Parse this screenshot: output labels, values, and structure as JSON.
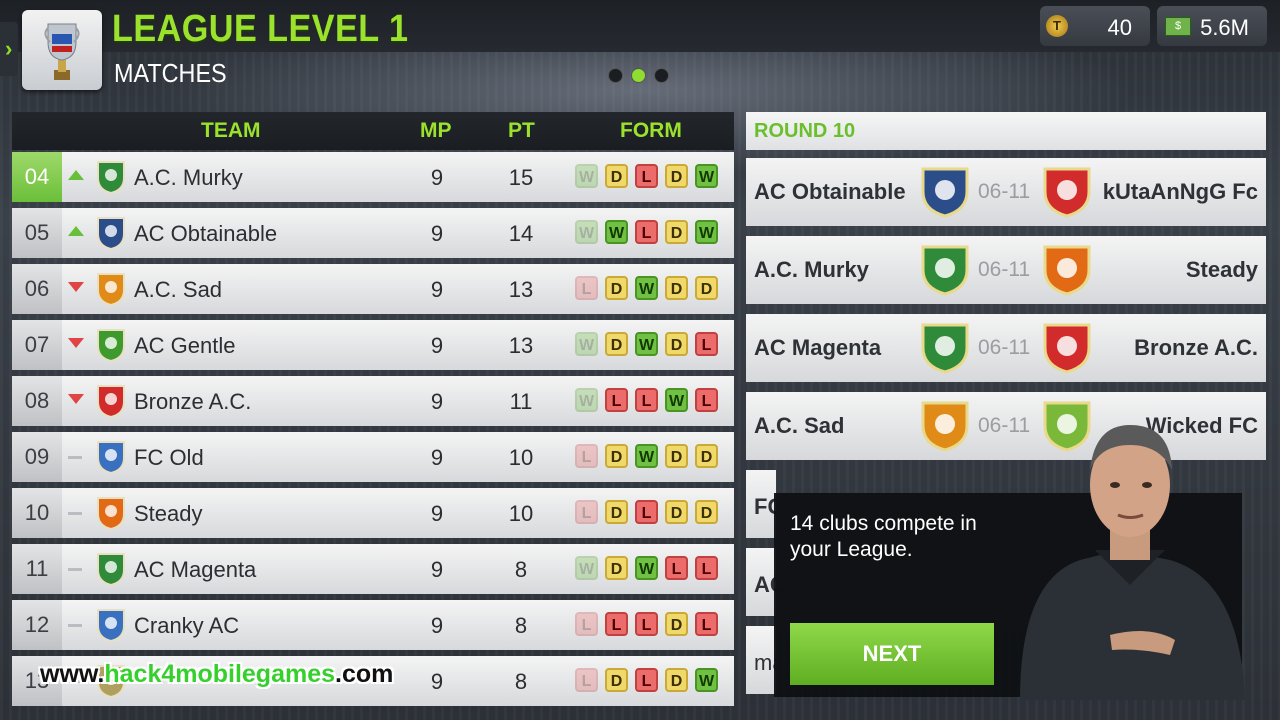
{
  "header": {
    "title": "LEAGUE LEVEL 1",
    "subtitle": "MATCHES",
    "coins": "40",
    "coin_icon_letter": "T",
    "cash": "5.6M",
    "cash_icon_symbol": "$",
    "page_dots": {
      "count": 3,
      "active": 2
    }
  },
  "table": {
    "headers": {
      "team": "TEAM",
      "mp": "MP",
      "pt": "PT",
      "form": "FORM"
    },
    "rows": [
      {
        "rank": "04",
        "trend": "up",
        "team": "A.C. Murky",
        "mp": "9",
        "pt": "15",
        "form": [
          "W",
          "D",
          "L",
          "D",
          "W"
        ],
        "faded": 1
      },
      {
        "rank": "05",
        "trend": "up",
        "team": "AC Obtainable",
        "mp": "9",
        "pt": "14",
        "form": [
          "W",
          "W",
          "L",
          "D",
          "W"
        ],
        "faded": 1
      },
      {
        "rank": "06",
        "trend": "down",
        "team": "A.C. Sad",
        "mp": "9",
        "pt": "13",
        "form": [
          "L",
          "D",
          "W",
          "D",
          "D"
        ],
        "faded": 1
      },
      {
        "rank": "07",
        "trend": "down",
        "team": "AC Gentle",
        "mp": "9",
        "pt": "13",
        "form": [
          "W",
          "D",
          "W",
          "D",
          "L"
        ],
        "faded": 1
      },
      {
        "rank": "08",
        "trend": "down",
        "team": "Bronze A.C.",
        "mp": "9",
        "pt": "11",
        "form": [
          "W",
          "L",
          "L",
          "W",
          "L"
        ],
        "faded": 1
      },
      {
        "rank": "09",
        "trend": "same",
        "team": "FC Old",
        "mp": "9",
        "pt": "10",
        "form": [
          "L",
          "D",
          "W",
          "D",
          "D"
        ],
        "faded": 1
      },
      {
        "rank": "10",
        "trend": "same",
        "team": "Steady",
        "mp": "9",
        "pt": "10",
        "form": [
          "L",
          "D",
          "L",
          "D",
          "D"
        ],
        "faded": 1
      },
      {
        "rank": "11",
        "trend": "same",
        "team": "AC Magenta",
        "mp": "9",
        "pt": "8",
        "form": [
          "W",
          "D",
          "W",
          "L",
          "L"
        ],
        "faded": 1
      },
      {
        "rank": "12",
        "trend": "same",
        "team": "Cranky AC",
        "mp": "9",
        "pt": "8",
        "form": [
          "L",
          "L",
          "L",
          "D",
          "L"
        ],
        "faded": 1
      },
      {
        "rank": "13",
        "trend": "same",
        "team": "",
        "mp": "9",
        "pt": "8",
        "form": [
          "L",
          "D",
          "L",
          "D",
          "W"
        ],
        "faded": 1
      }
    ]
  },
  "round": {
    "title": "ROUND 10",
    "matches": [
      {
        "home": "AC Obtainable",
        "date": "06-11",
        "away": "kUtaAnNgG Fc",
        "home_color": "#2b4d8a",
        "away_color": "#d22b2b"
      },
      {
        "home": "A.C. Murky",
        "date": "06-11",
        "away": "Steady",
        "home_color": "#2f8a3a",
        "away_color": "#e36a14"
      },
      {
        "home": "AC Magenta",
        "date": "06-11",
        "away": "Bronze A.C.",
        "home_color": "#2f8a3a",
        "away_color": "#d22b2b"
      },
      {
        "home": "A.C. Sad",
        "date": "06-11",
        "away": "Wicked FC",
        "home_color": "#e08a18",
        "away_color": "#7ab83a"
      }
    ],
    "partial_labels": [
      "FC",
      "AC",
      "ma"
    ]
  },
  "tip": {
    "text": "14 clubs compete in your League.",
    "button": "NEXT"
  },
  "watermark": {
    "part1": "www.",
    "part2": "hack4mobilegames",
    "part3": ".com"
  }
}
